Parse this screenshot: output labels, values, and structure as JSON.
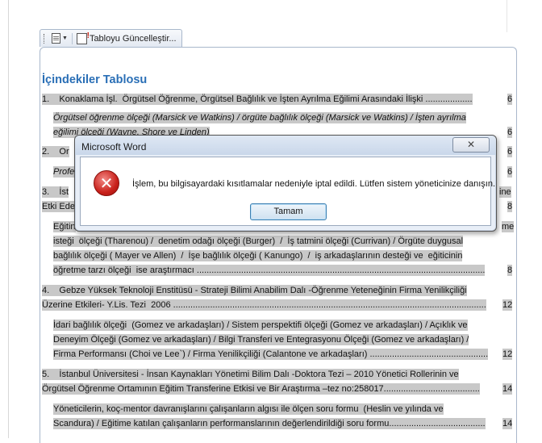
{
  "toolbar": {
    "update_label": "Tabloyu Güncelleştir..."
  },
  "toc": {
    "title": "İçindekiler Tablosu",
    "lines": [
      {
        "text": "1.    Konaklama İşl.  Örgütsel Öğrenme, Örgütsel Bağlılık ve İşten Ayrılma Eğilimi Arasındaki İlişki ...................",
        "page": "6"
      },
      {
        "text": "Örgütsel öğrenme ölçeği (Marsick ve Watkins) / örgüte bağlılık ölçeği (Marsick ve Watkins) / İşten ayrılma",
        "page": ""
      },
      {
        "text": "eğilimi ölçeği (Wayne, Shore ve Linden)",
        "page": "6"
      },
      {
        "text": "2.    Or",
        "page": "6"
      },
      {
        "text": "Profe",
        "page": "6"
      },
      {
        "text": "3.    İst",
        "page": "ine"
      },
      {
        "text": "Etki Ede",
        "page": "8"
      },
      {
        "text": "Eğitin",
        "page": "me"
      },
      {
        "text": "isteği  ölçeği (Tharenou) /  denetim odağı ölçeği (Burger)  /  İş tatmini ölçeği (Currivan) / Örgüte duygusal",
        "page": ""
      },
      {
        "text": "bağlılık ölçeği ( Mayer ve Allen)  /  İşe bağlılık ölçeği ( Kanungo)  /  iş arkadaşlarının desteği ve  eğiticinin",
        "page": ""
      },
      {
        "text": "öğretme tarzı ölçeği  ise araştırmacı .....................................................................................................................",
        "page": "8"
      },
      {
        "text": "4.    Gebze Yüksek Teknoloji Enstitüsü - Strateji Bilimi Anabilim Dalı -Öğrenme Yeteneğinin Firma Yenilikçiliği",
        "page": ""
      },
      {
        "text": "Üzerine Etkileri- Y.Lis. Tezi  2006 ...............................................................................................................................",
        "page": "12"
      },
      {
        "text": "İdari bağlılık ölçeği  (Gomez ve arkadaşları) / Sistem perspektifi ölçeği (Gomez ve arkadaşları) / Açıklık ve",
        "page": ""
      },
      {
        "text": "Deneyim Ölçeği (Gomez ve arkadaşları) / Bilgi Transferi ve Entegrasyonu Ölçeği (Gomez ve arkadaşları) /",
        "page": ""
      },
      {
        "text": "Firma Performansı (Choi ve Lee`) / Firma Yenilikçiliği (Calantone ve arkadaşları) ................................................",
        "page": "12"
      },
      {
        "text": "5.    İstanbul Üniversitesi - İnsan Kaynakları Yönetimi Bilim Dalı -Doktora Tezi – 2010 Yönetici Rollerinin ve",
        "page": ""
      },
      {
        "text": "Örgütsel Öğrenme Ortamının Eğitim Transferine Etkisi ve Bir Araştırma –tez no:258017.......................................",
        "page": "14"
      },
      {
        "text": "Yöneticilerin, koç-mentor davranışlarını çalışanların algısı ile ölçen soru formu  (Heslin ve yılında ve",
        "page": ""
      },
      {
        "text": "Scandura) / Eğitime katılan çalışanların performanslarının değerlendirildiği soru formu.......................................",
        "page": "14"
      }
    ]
  },
  "dialog": {
    "title": "Microsoft Word",
    "close_label": "✕",
    "message": "İşlem, bu bilgisayardaki kısıtlamalar nedeniyle iptal edildi. Lütfen sistem yöneticinize danışın.",
    "ok_label": "Tamam"
  }
}
